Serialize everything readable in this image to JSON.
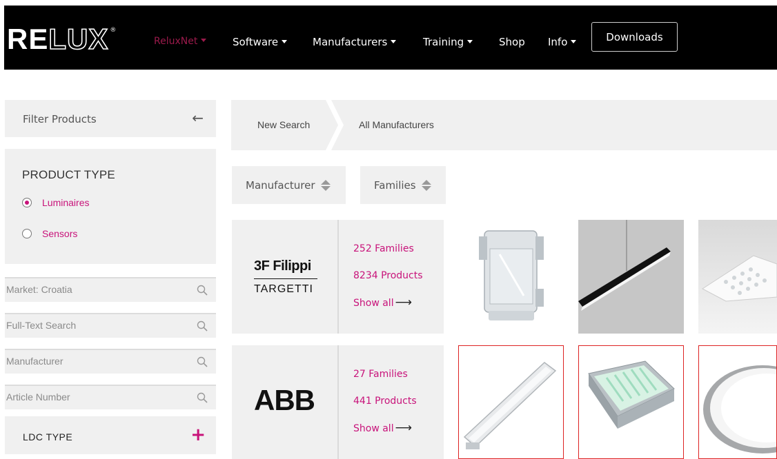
{
  "brand": {
    "logo_bold": "RE",
    "logo_outline": "LUX",
    "registered": "®"
  },
  "nav": {
    "items": [
      {
        "label": "ReluxNet",
        "dropdown": true,
        "active": true
      },
      {
        "label": "Software",
        "dropdown": true
      },
      {
        "label": "Manufacturers",
        "dropdown": true
      },
      {
        "label": "Training",
        "dropdown": true
      },
      {
        "label": "Shop",
        "dropdown": false
      },
      {
        "label": "Info",
        "dropdown": true
      }
    ],
    "downloads_label": "Downloads"
  },
  "sidebar": {
    "filter_title": "Filter Products",
    "product_type": {
      "heading": "PRODUCT TYPE",
      "options": [
        {
          "label": "Luminaires",
          "selected": true
        },
        {
          "label": "Sensors",
          "selected": false
        }
      ]
    },
    "inputs": [
      {
        "placeholder": "Market: Croatia"
      },
      {
        "placeholder": "Full-Text Search"
      },
      {
        "placeholder": "Manufacturer"
      },
      {
        "placeholder": "Article Number"
      }
    ],
    "ldc_type": "LDC TYPE"
  },
  "breadcrumb": {
    "new_search": "New Search",
    "current": "All Manufacturers"
  },
  "sort": {
    "manufacturer": "Manufacturer",
    "families": "Families"
  },
  "manufacturers": [
    {
      "logo_line1": "3F Filippi",
      "logo_line2": "TARGETTI",
      "families": "252 Families",
      "products": "8234 Products",
      "show_all": "Show all"
    },
    {
      "logo": "ABB",
      "families": "27 Families",
      "products": "441 Products",
      "show_all": "Show all"
    }
  ],
  "colors": {
    "accent": "#c8137a",
    "nav_bg": "#000000",
    "panel_bg": "#f0f0f0",
    "tile_border": "#dd2222"
  }
}
